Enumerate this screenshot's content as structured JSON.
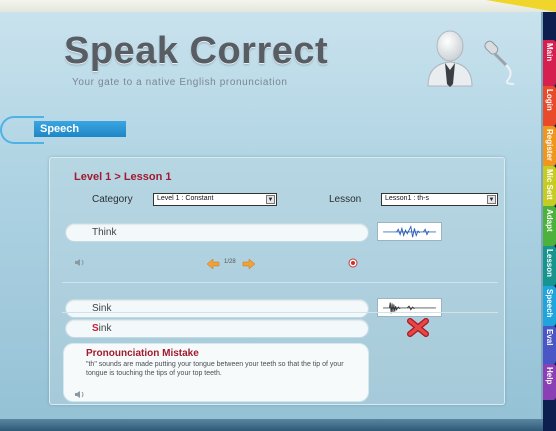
{
  "app": {
    "title": "Speak Correct",
    "tagline": "Your gate to a native English pronunciation"
  },
  "section_tab": "Speech",
  "breadcrumb": "Level 1 > Lesson 1",
  "filters": {
    "category_label": "Category",
    "category_value": "Level 1 : Constant",
    "lesson_label": "Lesson",
    "lesson_value": "Lesson1 : th-s"
  },
  "words": {
    "target": "Think",
    "pager": "1/28",
    "spoken": "Sink",
    "recognized_first": "S",
    "recognized_rest": "ink"
  },
  "mistake": {
    "title": "Pronounciation Mistake",
    "text": "\"th\" sounds are made putting your tongue between your teeth so that the tip of your tongue is touching the tips of your top teeth."
  },
  "side_tabs": [
    {
      "label": "Main",
      "color": "#d61f4f"
    },
    {
      "label": "Login",
      "color": "#e84a2a"
    },
    {
      "label": "Register",
      "color": "#f0961e"
    },
    {
      "label": "Mic Sett",
      "color": "#c7cc22"
    },
    {
      "label": "Adapt",
      "color": "#4cb23c"
    },
    {
      "label": "Lesson",
      "color": "#17948d"
    },
    {
      "label": "Speech",
      "color": "#1fa4de"
    },
    {
      "label": "Eval",
      "color": "#4b56c6"
    },
    {
      "label": "Help",
      "color": "#8a3fb5"
    }
  ],
  "colors": {
    "accent_red": "#a11a2e",
    "tab_blue": "#1f86c6",
    "background": "#aed3e3"
  }
}
